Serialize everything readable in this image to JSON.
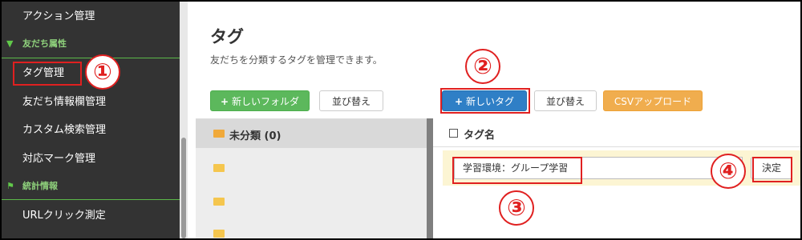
{
  "sidebar": {
    "items": [
      {
        "label": "アクション管理"
      },
      {
        "label": "タグ管理"
      },
      {
        "label": "友だち情報欄管理"
      },
      {
        "label": "カスタム検索管理"
      },
      {
        "label": "対応マーク管理"
      },
      {
        "label": "URLクリック測定"
      }
    ],
    "sections": [
      {
        "label": "友だち属性",
        "icon": "filter-icon"
      },
      {
        "label": "統計情報",
        "icon": "flag-icon"
      }
    ]
  },
  "main": {
    "title": "タグ",
    "description": "友だちを分類するタグを管理できます。",
    "toolbar": {
      "new_folder_label": "新しいフォルダ",
      "folder_sort_label": "並び替え",
      "new_tag_label": "新しいタグ",
      "tag_sort_label": "並び替え",
      "csv_upload_label": "CSVアップロード"
    },
    "folders": [
      {
        "label": "未分類 (0)",
        "icon": "folder-open-icon"
      }
    ],
    "tag_list": {
      "header_label": "タグ名",
      "new_tag_input_value": "学習環境：グループ学習",
      "decide_label": "決定"
    }
  },
  "annotations": {
    "step1": "①",
    "step2": "②",
    "step3": "③",
    "step4": "④",
    "highlight_color": "#e02020"
  }
}
